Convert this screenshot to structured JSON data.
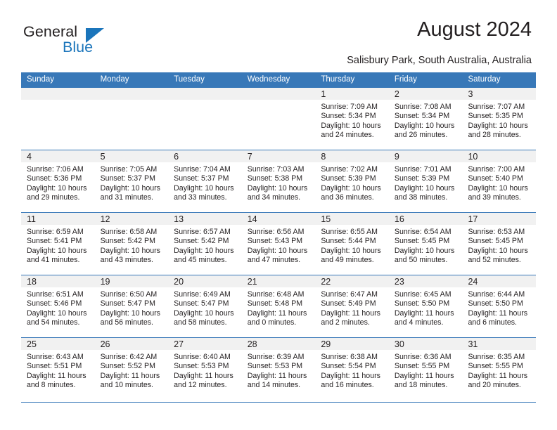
{
  "brand": {
    "name_part1": "General",
    "name_part2": "Blue",
    "logo_icon": "triangle-icon",
    "accent_color": "#1b75bb"
  },
  "header": {
    "title": "August 2024",
    "location": "Salisbury Park, South Australia, Australia"
  },
  "calendar": {
    "header_bg": "#3878b8",
    "daynum_band_bg": "#f1f1f1",
    "weekdays": [
      "Sunday",
      "Monday",
      "Tuesday",
      "Wednesday",
      "Thursday",
      "Friday",
      "Saturday"
    ],
    "weeks": [
      [
        {
          "day": "",
          "sunrise": "",
          "sunset": "",
          "daylight1": "",
          "daylight2": ""
        },
        {
          "day": "",
          "sunrise": "",
          "sunset": "",
          "daylight1": "",
          "daylight2": ""
        },
        {
          "day": "",
          "sunrise": "",
          "sunset": "",
          "daylight1": "",
          "daylight2": ""
        },
        {
          "day": "",
          "sunrise": "",
          "sunset": "",
          "daylight1": "",
          "daylight2": ""
        },
        {
          "day": "1",
          "sunrise": "Sunrise: 7:09 AM",
          "sunset": "Sunset: 5:34 PM",
          "daylight1": "Daylight: 10 hours",
          "daylight2": "and 24 minutes."
        },
        {
          "day": "2",
          "sunrise": "Sunrise: 7:08 AM",
          "sunset": "Sunset: 5:34 PM",
          "daylight1": "Daylight: 10 hours",
          "daylight2": "and 26 minutes."
        },
        {
          "day": "3",
          "sunrise": "Sunrise: 7:07 AM",
          "sunset": "Sunset: 5:35 PM",
          "daylight1": "Daylight: 10 hours",
          "daylight2": "and 28 minutes."
        }
      ],
      [
        {
          "day": "4",
          "sunrise": "Sunrise: 7:06 AM",
          "sunset": "Sunset: 5:36 PM",
          "daylight1": "Daylight: 10 hours",
          "daylight2": "and 29 minutes."
        },
        {
          "day": "5",
          "sunrise": "Sunrise: 7:05 AM",
          "sunset": "Sunset: 5:37 PM",
          "daylight1": "Daylight: 10 hours",
          "daylight2": "and 31 minutes."
        },
        {
          "day": "6",
          "sunrise": "Sunrise: 7:04 AM",
          "sunset": "Sunset: 5:37 PM",
          "daylight1": "Daylight: 10 hours",
          "daylight2": "and 33 minutes."
        },
        {
          "day": "7",
          "sunrise": "Sunrise: 7:03 AM",
          "sunset": "Sunset: 5:38 PM",
          "daylight1": "Daylight: 10 hours",
          "daylight2": "and 34 minutes."
        },
        {
          "day": "8",
          "sunrise": "Sunrise: 7:02 AM",
          "sunset": "Sunset: 5:39 PM",
          "daylight1": "Daylight: 10 hours",
          "daylight2": "and 36 minutes."
        },
        {
          "day": "9",
          "sunrise": "Sunrise: 7:01 AM",
          "sunset": "Sunset: 5:39 PM",
          "daylight1": "Daylight: 10 hours",
          "daylight2": "and 38 minutes."
        },
        {
          "day": "10",
          "sunrise": "Sunrise: 7:00 AM",
          "sunset": "Sunset: 5:40 PM",
          "daylight1": "Daylight: 10 hours",
          "daylight2": "and 39 minutes."
        }
      ],
      [
        {
          "day": "11",
          "sunrise": "Sunrise: 6:59 AM",
          "sunset": "Sunset: 5:41 PM",
          "daylight1": "Daylight: 10 hours",
          "daylight2": "and 41 minutes."
        },
        {
          "day": "12",
          "sunrise": "Sunrise: 6:58 AM",
          "sunset": "Sunset: 5:42 PM",
          "daylight1": "Daylight: 10 hours",
          "daylight2": "and 43 minutes."
        },
        {
          "day": "13",
          "sunrise": "Sunrise: 6:57 AM",
          "sunset": "Sunset: 5:42 PM",
          "daylight1": "Daylight: 10 hours",
          "daylight2": "and 45 minutes."
        },
        {
          "day": "14",
          "sunrise": "Sunrise: 6:56 AM",
          "sunset": "Sunset: 5:43 PM",
          "daylight1": "Daylight: 10 hours",
          "daylight2": "and 47 minutes."
        },
        {
          "day": "15",
          "sunrise": "Sunrise: 6:55 AM",
          "sunset": "Sunset: 5:44 PM",
          "daylight1": "Daylight: 10 hours",
          "daylight2": "and 49 minutes."
        },
        {
          "day": "16",
          "sunrise": "Sunrise: 6:54 AM",
          "sunset": "Sunset: 5:45 PM",
          "daylight1": "Daylight: 10 hours",
          "daylight2": "and 50 minutes."
        },
        {
          "day": "17",
          "sunrise": "Sunrise: 6:53 AM",
          "sunset": "Sunset: 5:45 PM",
          "daylight1": "Daylight: 10 hours",
          "daylight2": "and 52 minutes."
        }
      ],
      [
        {
          "day": "18",
          "sunrise": "Sunrise: 6:51 AM",
          "sunset": "Sunset: 5:46 PM",
          "daylight1": "Daylight: 10 hours",
          "daylight2": "and 54 minutes."
        },
        {
          "day": "19",
          "sunrise": "Sunrise: 6:50 AM",
          "sunset": "Sunset: 5:47 PM",
          "daylight1": "Daylight: 10 hours",
          "daylight2": "and 56 minutes."
        },
        {
          "day": "20",
          "sunrise": "Sunrise: 6:49 AM",
          "sunset": "Sunset: 5:47 PM",
          "daylight1": "Daylight: 10 hours",
          "daylight2": "and 58 minutes."
        },
        {
          "day": "21",
          "sunrise": "Sunrise: 6:48 AM",
          "sunset": "Sunset: 5:48 PM",
          "daylight1": "Daylight: 11 hours",
          "daylight2": "and 0 minutes."
        },
        {
          "day": "22",
          "sunrise": "Sunrise: 6:47 AM",
          "sunset": "Sunset: 5:49 PM",
          "daylight1": "Daylight: 11 hours",
          "daylight2": "and 2 minutes."
        },
        {
          "day": "23",
          "sunrise": "Sunrise: 6:45 AM",
          "sunset": "Sunset: 5:50 PM",
          "daylight1": "Daylight: 11 hours",
          "daylight2": "and 4 minutes."
        },
        {
          "day": "24",
          "sunrise": "Sunrise: 6:44 AM",
          "sunset": "Sunset: 5:50 PM",
          "daylight1": "Daylight: 11 hours",
          "daylight2": "and 6 minutes."
        }
      ],
      [
        {
          "day": "25",
          "sunrise": "Sunrise: 6:43 AM",
          "sunset": "Sunset: 5:51 PM",
          "daylight1": "Daylight: 11 hours",
          "daylight2": "and 8 minutes."
        },
        {
          "day": "26",
          "sunrise": "Sunrise: 6:42 AM",
          "sunset": "Sunset: 5:52 PM",
          "daylight1": "Daylight: 11 hours",
          "daylight2": "and 10 minutes."
        },
        {
          "day": "27",
          "sunrise": "Sunrise: 6:40 AM",
          "sunset": "Sunset: 5:53 PM",
          "daylight1": "Daylight: 11 hours",
          "daylight2": "and 12 minutes."
        },
        {
          "day": "28",
          "sunrise": "Sunrise: 6:39 AM",
          "sunset": "Sunset: 5:53 PM",
          "daylight1": "Daylight: 11 hours",
          "daylight2": "and 14 minutes."
        },
        {
          "day": "29",
          "sunrise": "Sunrise: 6:38 AM",
          "sunset": "Sunset: 5:54 PM",
          "daylight1": "Daylight: 11 hours",
          "daylight2": "and 16 minutes."
        },
        {
          "day": "30",
          "sunrise": "Sunrise: 6:36 AM",
          "sunset": "Sunset: 5:55 PM",
          "daylight1": "Daylight: 11 hours",
          "daylight2": "and 18 minutes."
        },
        {
          "day": "31",
          "sunrise": "Sunrise: 6:35 AM",
          "sunset": "Sunset: 5:55 PM",
          "daylight1": "Daylight: 11 hours",
          "daylight2": "and 20 minutes."
        }
      ]
    ]
  }
}
